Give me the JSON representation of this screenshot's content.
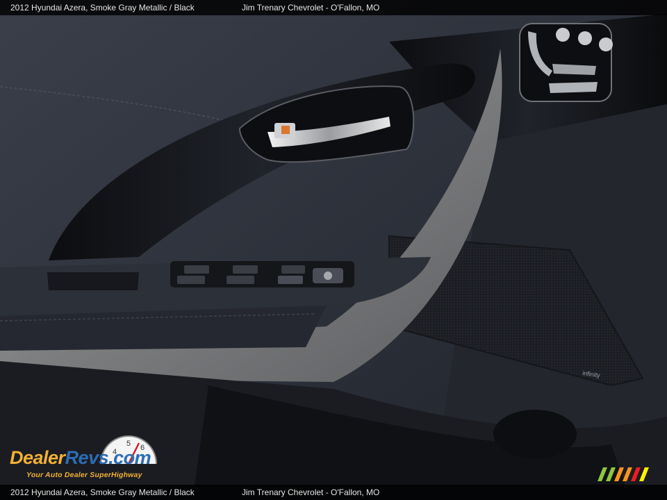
{
  "caption": {
    "left": "2012 Hyundai Azera,  Smoke Gray Metallic / Black",
    "right": "Jim Trenary Chevrolet - O'Fallon, MO"
  },
  "watermark": {
    "name_part1": "Dealer",
    "name_part2": "Revs",
    "name_part3": ".com",
    "tagline": "Your Auto Dealer SuperHighway",
    "gauge_digits": [
      "4",
      "5",
      "6"
    ]
  },
  "photo": {
    "subject": "Interior door panel with window switches, chrome door handle and seat controls",
    "speaker_badge": "infinity"
  },
  "colors": {
    "panel_dark": "#1b1d22",
    "leather": "#2b2f38",
    "trim_silver": "#8d8e8f",
    "caption_bg": "#000000",
    "logo_orange": "#f2b134",
    "logo_blue": "#2c6db4"
  }
}
